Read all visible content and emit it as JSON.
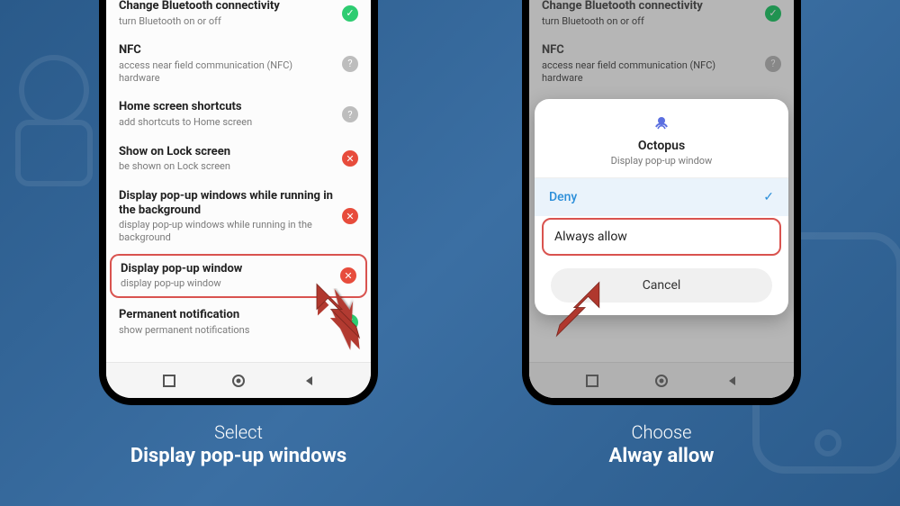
{
  "left": {
    "caption_line1": "Select",
    "caption_line2": "Display pop-up windows",
    "items": [
      {
        "title": "Change Bluetooth connectivity",
        "sub": "turn Bluetooth on or off",
        "status": "green"
      },
      {
        "title": "NFC",
        "sub": "access near field communication (NFC) hardware",
        "status": "gray"
      },
      {
        "title": "Home screen shortcuts",
        "sub": "add shortcuts to Home screen",
        "status": "gray"
      },
      {
        "title": "Show on Lock screen",
        "sub": "be shown on Lock screen",
        "status": "red"
      },
      {
        "title": "Display pop-up windows while running in the background",
        "sub": "display pop-up windows while running in the background",
        "status": "red"
      },
      {
        "title": "Display pop-up window",
        "sub": "display pop-up window",
        "status": "red",
        "highlight": true
      },
      {
        "title": "Permanent notification",
        "sub": "show permanent notifications",
        "status": "green"
      }
    ]
  },
  "right": {
    "caption_line1": "Choose",
    "caption_line2": "Alway allow",
    "bg_items": [
      {
        "title": "Change Bluetooth connectivity",
        "sub": "turn Bluetooth on or off",
        "status": "green"
      },
      {
        "title": "NFC",
        "sub": "access near field communication (NFC) hardware",
        "status": "gray"
      }
    ],
    "dialog": {
      "app": "Octopus",
      "subtitle": "Display pop-up window",
      "deny": "Deny",
      "allow": "Always allow",
      "cancel": "Cancel"
    }
  }
}
